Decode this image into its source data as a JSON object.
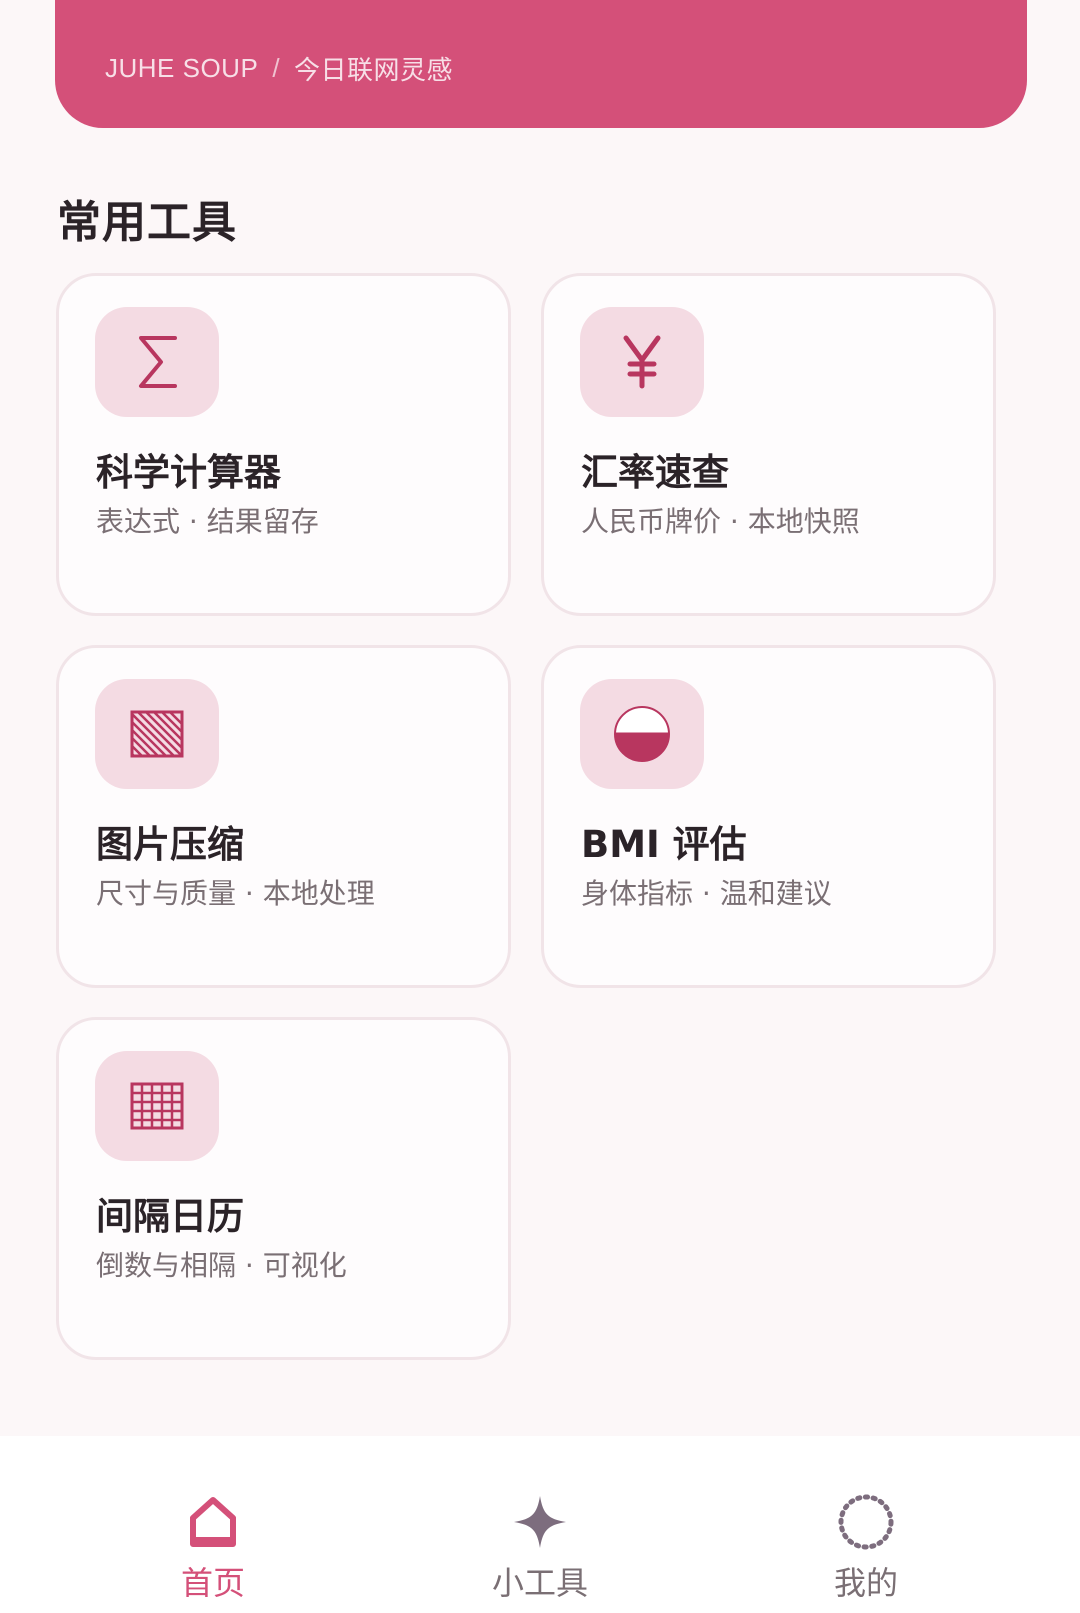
{
  "hero": {
    "breadcrumb_primary": "JUHE SOUP",
    "breadcrumb_separator": "/",
    "breadcrumb_secondary": "今日联网灵感"
  },
  "section": {
    "title": "常用工具"
  },
  "tools": [
    {
      "title": "科学计算器",
      "subtitle": "表达式 · 结果留存",
      "icon": "sigma-icon"
    },
    {
      "title": "汇率速查",
      "subtitle": "人民币牌价 · 本地快照",
      "icon": "yen-icon"
    },
    {
      "title": "图片压缩",
      "subtitle": "尺寸与质量 · 本地处理",
      "icon": "hatched-square-icon"
    },
    {
      "title": "BMI 评估",
      "subtitle": "身体指标 · 温和建议",
      "icon": "half-circle-icon"
    },
    {
      "title": "间隔日历",
      "subtitle": "倒数与相隔 · 可视化",
      "icon": "grid-icon"
    }
  ],
  "nav": {
    "home": "首页",
    "tools": "小工具",
    "me": "我的",
    "active": "home"
  },
  "colors": {
    "accent": "#d45079",
    "icon_bg": "#f4dbe3",
    "icon_fg": "#b8365f",
    "nav_inactive": "#7a6f74"
  }
}
